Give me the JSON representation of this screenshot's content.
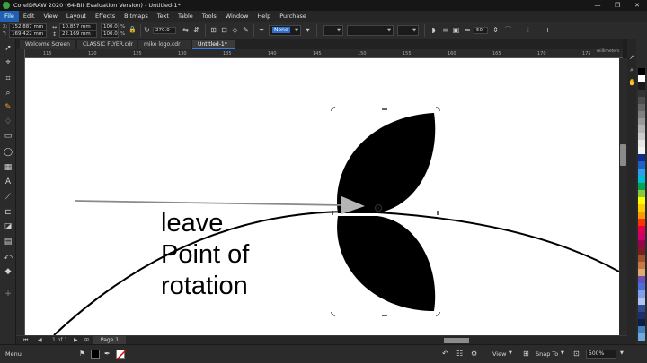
{
  "window": {
    "title": "CorelDRAW 2020 (64-Bit Evaluation Version) - Untitled-1*",
    "controls": [
      "—",
      "❐",
      "✕"
    ]
  },
  "menu": [
    "File",
    "Edit",
    "View",
    "Layout",
    "Effects",
    "Bitmaps",
    "Text",
    "Table",
    "Tools",
    "Window",
    "Help",
    "Purchase"
  ],
  "menu_active": "File",
  "property_bar": {
    "x_label": "X:",
    "x_value": "152.887 mm",
    "y_label": "Y:",
    "y_value": "169.422 mm",
    "w_value": "10.857 mm",
    "h_value": "22.169 mm",
    "scale_w": "100.0",
    "scale_h": "100.0",
    "pct": "%",
    "angle": "270.0",
    "fill_value": "None",
    "stroke_value": "50"
  },
  "tabs": [
    {
      "label": "Welcome Screen",
      "active": false
    },
    {
      "label": "CLASSIC FLYER.cdr",
      "active": false
    },
    {
      "label": "mike logo.cdr",
      "active": false
    },
    {
      "label": "Untitled-1*",
      "active": true
    }
  ],
  "ruler": {
    "ticks": [
      "115",
      "120",
      "125",
      "130",
      "135",
      "140",
      "145",
      "150",
      "155",
      "160",
      "165",
      "170",
      "175"
    ],
    "unit": "millimeters"
  },
  "canvas": {
    "text_lines": [
      "leave",
      "Point of",
      "rotation"
    ]
  },
  "page_bar": {
    "page_tab": "Page 1"
  },
  "status_bar": {
    "menu": "Menu",
    "view": "View",
    "snap": "Snap To",
    "zoom": "500%"
  },
  "palette": [
    "#000000",
    "#ffffff",
    "#1a1a1a",
    "#333333",
    "#4d4d4d",
    "#666666",
    "#808080",
    "#999999",
    "#b3b3b3",
    "#cccccc",
    "#e6e6e6",
    "#f2f2f2",
    "#0d2b8a",
    "#1f5fc9",
    "#2fa0e8",
    "#00bcd4",
    "#00a651",
    "#8dc63f",
    "#ffff00",
    "#ffcc00",
    "#ff9900",
    "#ff3300",
    "#e6004c",
    "#cc0066",
    "#99004d",
    "#7a1f1f",
    "#a0522d",
    "#c87941",
    "#e0a96d",
    "#6b4fbb",
    "#4a6fdc",
    "#7f9fe8",
    "#b0c4f0",
    "#2e4a8c",
    "#1c2f6b",
    "#0f1d45",
    "#3f7fbf",
    "#6fa8dc"
  ]
}
